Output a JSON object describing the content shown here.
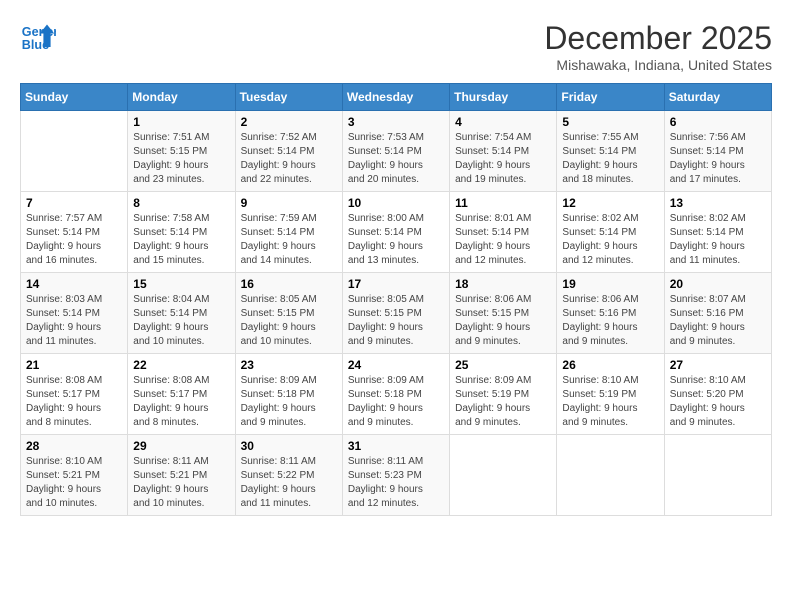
{
  "logo": {
    "line1": "General",
    "line2": "Blue"
  },
  "title": "December 2025",
  "subtitle": "Mishawaka, Indiana, United States",
  "weekdays": [
    "Sunday",
    "Monday",
    "Tuesday",
    "Wednesday",
    "Thursday",
    "Friday",
    "Saturday"
  ],
  "weeks": [
    [
      {
        "day": "",
        "info": ""
      },
      {
        "day": "1",
        "info": "Sunrise: 7:51 AM\nSunset: 5:15 PM\nDaylight: 9 hours\nand 23 minutes."
      },
      {
        "day": "2",
        "info": "Sunrise: 7:52 AM\nSunset: 5:14 PM\nDaylight: 9 hours\nand 22 minutes."
      },
      {
        "day": "3",
        "info": "Sunrise: 7:53 AM\nSunset: 5:14 PM\nDaylight: 9 hours\nand 20 minutes."
      },
      {
        "day": "4",
        "info": "Sunrise: 7:54 AM\nSunset: 5:14 PM\nDaylight: 9 hours\nand 19 minutes."
      },
      {
        "day": "5",
        "info": "Sunrise: 7:55 AM\nSunset: 5:14 PM\nDaylight: 9 hours\nand 18 minutes."
      },
      {
        "day": "6",
        "info": "Sunrise: 7:56 AM\nSunset: 5:14 PM\nDaylight: 9 hours\nand 17 minutes."
      }
    ],
    [
      {
        "day": "7",
        "info": "Sunrise: 7:57 AM\nSunset: 5:14 PM\nDaylight: 9 hours\nand 16 minutes."
      },
      {
        "day": "8",
        "info": "Sunrise: 7:58 AM\nSunset: 5:14 PM\nDaylight: 9 hours\nand 15 minutes."
      },
      {
        "day": "9",
        "info": "Sunrise: 7:59 AM\nSunset: 5:14 PM\nDaylight: 9 hours\nand 14 minutes."
      },
      {
        "day": "10",
        "info": "Sunrise: 8:00 AM\nSunset: 5:14 PM\nDaylight: 9 hours\nand 13 minutes."
      },
      {
        "day": "11",
        "info": "Sunrise: 8:01 AM\nSunset: 5:14 PM\nDaylight: 9 hours\nand 12 minutes."
      },
      {
        "day": "12",
        "info": "Sunrise: 8:02 AM\nSunset: 5:14 PM\nDaylight: 9 hours\nand 12 minutes."
      },
      {
        "day": "13",
        "info": "Sunrise: 8:02 AM\nSunset: 5:14 PM\nDaylight: 9 hours\nand 11 minutes."
      }
    ],
    [
      {
        "day": "14",
        "info": "Sunrise: 8:03 AM\nSunset: 5:14 PM\nDaylight: 9 hours\nand 11 minutes."
      },
      {
        "day": "15",
        "info": "Sunrise: 8:04 AM\nSunset: 5:14 PM\nDaylight: 9 hours\nand 10 minutes."
      },
      {
        "day": "16",
        "info": "Sunrise: 8:05 AM\nSunset: 5:15 PM\nDaylight: 9 hours\nand 10 minutes."
      },
      {
        "day": "17",
        "info": "Sunrise: 8:05 AM\nSunset: 5:15 PM\nDaylight: 9 hours\nand 9 minutes."
      },
      {
        "day": "18",
        "info": "Sunrise: 8:06 AM\nSunset: 5:15 PM\nDaylight: 9 hours\nand 9 minutes."
      },
      {
        "day": "19",
        "info": "Sunrise: 8:06 AM\nSunset: 5:16 PM\nDaylight: 9 hours\nand 9 minutes."
      },
      {
        "day": "20",
        "info": "Sunrise: 8:07 AM\nSunset: 5:16 PM\nDaylight: 9 hours\nand 9 minutes."
      }
    ],
    [
      {
        "day": "21",
        "info": "Sunrise: 8:08 AM\nSunset: 5:17 PM\nDaylight: 9 hours\nand 8 minutes."
      },
      {
        "day": "22",
        "info": "Sunrise: 8:08 AM\nSunset: 5:17 PM\nDaylight: 9 hours\nand 8 minutes."
      },
      {
        "day": "23",
        "info": "Sunrise: 8:09 AM\nSunset: 5:18 PM\nDaylight: 9 hours\nand 9 minutes."
      },
      {
        "day": "24",
        "info": "Sunrise: 8:09 AM\nSunset: 5:18 PM\nDaylight: 9 hours\nand 9 minutes."
      },
      {
        "day": "25",
        "info": "Sunrise: 8:09 AM\nSunset: 5:19 PM\nDaylight: 9 hours\nand 9 minutes."
      },
      {
        "day": "26",
        "info": "Sunrise: 8:10 AM\nSunset: 5:19 PM\nDaylight: 9 hours\nand 9 minutes."
      },
      {
        "day": "27",
        "info": "Sunrise: 8:10 AM\nSunset: 5:20 PM\nDaylight: 9 hours\nand 9 minutes."
      }
    ],
    [
      {
        "day": "28",
        "info": "Sunrise: 8:10 AM\nSunset: 5:21 PM\nDaylight: 9 hours\nand 10 minutes."
      },
      {
        "day": "29",
        "info": "Sunrise: 8:11 AM\nSunset: 5:21 PM\nDaylight: 9 hours\nand 10 minutes."
      },
      {
        "day": "30",
        "info": "Sunrise: 8:11 AM\nSunset: 5:22 PM\nDaylight: 9 hours\nand 11 minutes."
      },
      {
        "day": "31",
        "info": "Sunrise: 8:11 AM\nSunset: 5:23 PM\nDaylight: 9 hours\nand 12 minutes."
      },
      {
        "day": "",
        "info": ""
      },
      {
        "day": "",
        "info": ""
      },
      {
        "day": "",
        "info": ""
      }
    ]
  ]
}
